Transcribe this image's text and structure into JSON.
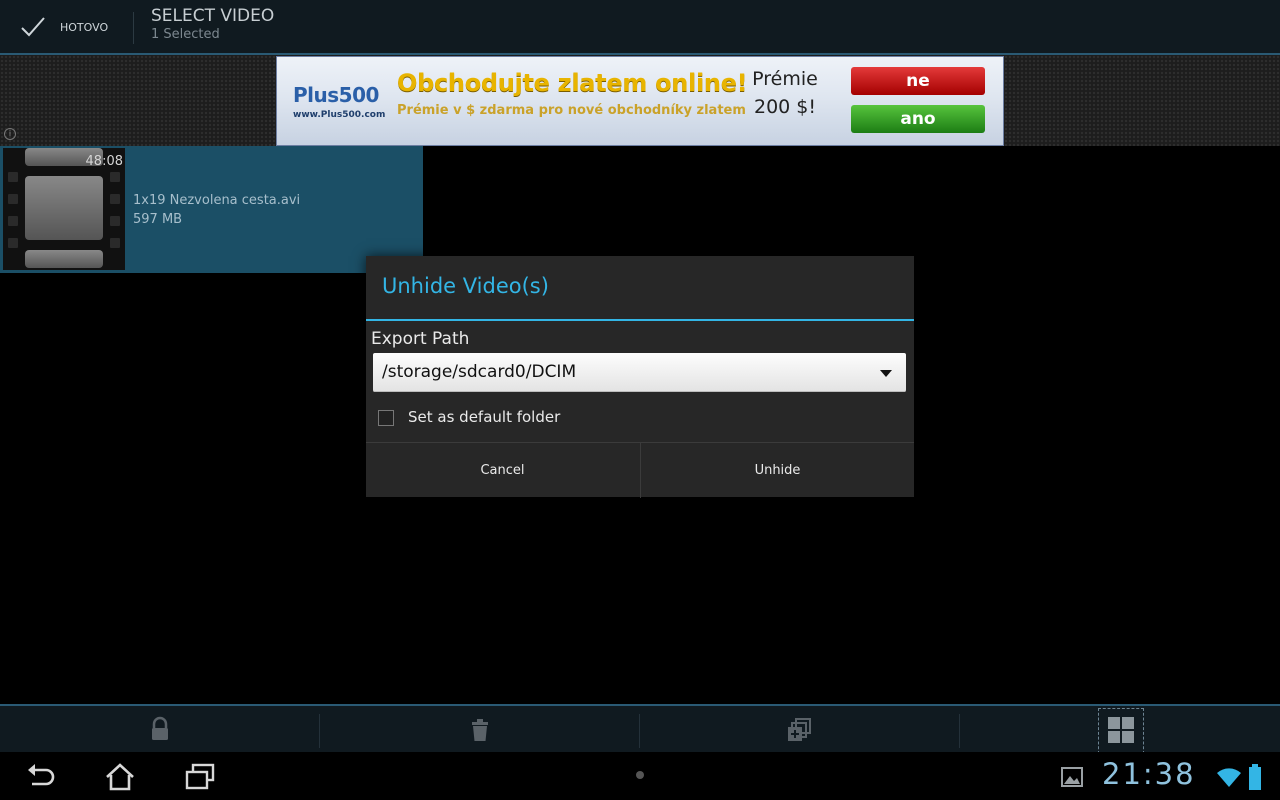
{
  "action_bar": {
    "done_label": "HOTOVO",
    "title": "SELECT VIDEO",
    "subtitle": "1 Selected"
  },
  "ad": {
    "brand": "Plus500",
    "url": "www.Plus500.com",
    "headline": "Obchodujte zlatem online!",
    "subline": "Prémie v $ zdarma pro nové obchodníky zlatem",
    "bonus": "Prémie 200 $!",
    "no_label": "ne",
    "yes_label": "ano",
    "info_label": "i"
  },
  "video_item": {
    "duration": "48:08",
    "name": "1x19 Nezvolena cesta.avi",
    "size": "597 MB"
  },
  "dialog": {
    "title": "Unhide Video(s)",
    "export_label": "Export Path",
    "path_value": "/storage/sdcard0/DCIM",
    "default_checkbox_label": "Set as default folder",
    "default_checked": false,
    "cancel_label": "Cancel",
    "confirm_label": "Unhide",
    "accent_color": "#33b5e5"
  },
  "bottom_bar": {
    "actions": [
      "lock-icon",
      "trash-icon",
      "add-to-album-icon",
      "grid-view-icon"
    ]
  },
  "system_bar": {
    "clock": "21:38",
    "icons": [
      "back-icon",
      "home-icon",
      "recent-apps-icon",
      "gallery-notification-icon",
      "wifi-icon",
      "battery-icon"
    ]
  }
}
